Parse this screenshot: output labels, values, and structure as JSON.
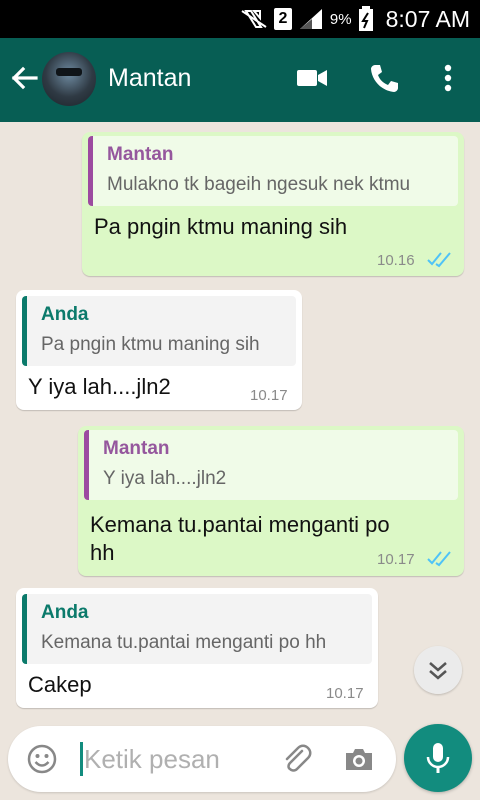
{
  "status_bar": {
    "sim_label": "2",
    "battery_percent": "9%",
    "time": "8:07 AM"
  },
  "header": {
    "contact_name": "Mantan"
  },
  "messages": [
    {
      "direction": "outgoing",
      "quote_author": "Mantan",
      "quote_text": "Mulakno tk bageih ngesuk nek ktmu",
      "text": "Pa pngin ktmu maning sih",
      "time": "10.16",
      "status": "read"
    },
    {
      "direction": "incoming",
      "quote_author": "Anda",
      "quote_text": "Pa pngin ktmu maning sih",
      "text": "Y iya lah....jln2",
      "time": "10.17"
    },
    {
      "direction": "outgoing",
      "quote_author": "Mantan",
      "quote_text": "Y iya lah....jln2",
      "text_line1": "Kemana tu.pantai menganti po",
      "text_line2": "hh",
      "time": "10.17",
      "status": "read"
    },
    {
      "direction": "incoming",
      "quote_author": "Anda",
      "quote_text": "Kemana tu.pantai menganti po hh",
      "text": "Cakep",
      "time": "10.17"
    }
  ],
  "composer": {
    "placeholder": "Ketik pesan"
  },
  "colors": {
    "header": "#075e54",
    "accent": "#128c7e",
    "outgoing_bubble": "#dcf8c6",
    "incoming_bubble": "#ffffff",
    "read_tick": "#4fc3f7"
  }
}
